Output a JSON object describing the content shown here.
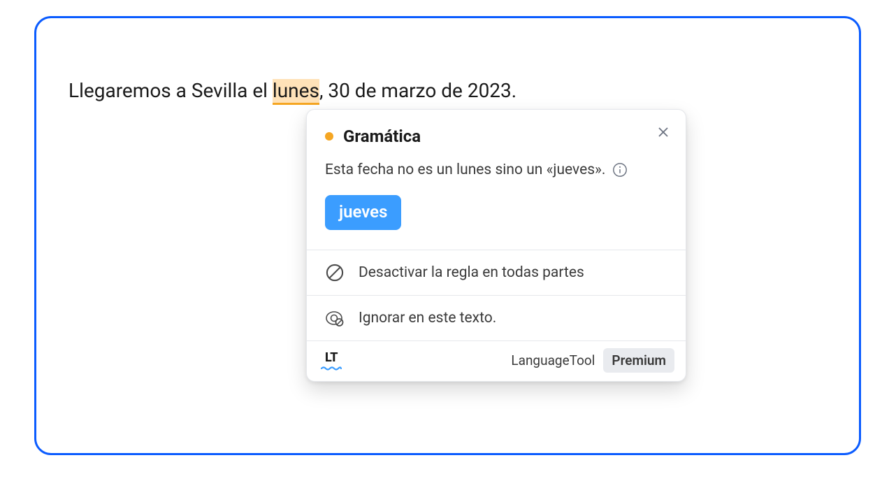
{
  "sentence": {
    "before": "Llegaremos a Sevilla el ",
    "highlight": "lunes",
    "after": ", 30 de marzo de 2023."
  },
  "popup": {
    "category": "Gramática",
    "description": "Esta fecha no es un lunes sino un «jueves».",
    "suggestion": "jueves",
    "disable_rule": "Desactivar la regla en todas partes",
    "ignore_text": "Ignorar en este texto.",
    "brand": "LanguageTool",
    "premium": "Premium",
    "logo_short": "LT"
  },
  "colors": {
    "accent": "#0b5cff",
    "warning": "#f5a623",
    "suggestion_bg": "#3b9dff"
  }
}
